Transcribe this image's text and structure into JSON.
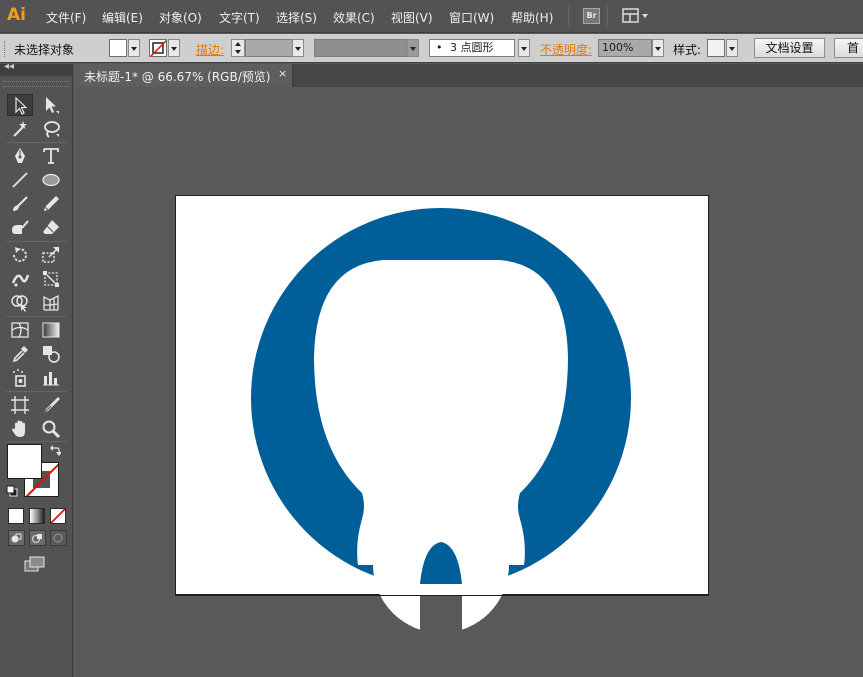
{
  "app": {
    "logo": "Ai"
  },
  "menu": {
    "items": [
      "文件(F)",
      "编辑(E)",
      "对象(O)",
      "文字(T)",
      "选择(S)",
      "效果(C)",
      "视图(V)",
      "窗口(W)",
      "帮助(H)"
    ],
    "bridge_label": "Br"
  },
  "control_bar": {
    "selection_status": "未选择对象",
    "stroke_label": "描边",
    "brush_value": "3 点圆形",
    "opacity_label": "不透明度",
    "opacity_value": "100%",
    "style_label": "样式",
    "doc_setup_button": "文档设置",
    "prefs_button": "首"
  },
  "document": {
    "tab_title": "未标题-1* @ 66.67% (RGB/预览)",
    "close_glyph": "×"
  },
  "artwork": {
    "logo_color": "#005f99",
    "fill_color": "#ffffff"
  },
  "tools": {
    "collapse_glyph": "◂◂",
    "list": [
      "selection-tool",
      "direct-selection-tool",
      "magic-wand-tool",
      "lasso-tool",
      "pen-tool",
      "type-tool",
      "line-segment-tool",
      "ellipse-tool",
      "paintbrush-tool",
      "pencil-tool",
      "blob-brush-tool",
      "eraser-tool",
      "rotate-tool",
      "scale-tool",
      "width-tool",
      "free-transform-tool",
      "shape-builder-tool",
      "perspective-grid-tool",
      "mesh-tool",
      "gradient-tool",
      "eyedropper-tool",
      "blend-tool",
      "symbol-sprayer-tool",
      "column-graph-tool",
      "artboard-tool",
      "slice-tool",
      "hand-tool",
      "zoom-tool"
    ]
  }
}
